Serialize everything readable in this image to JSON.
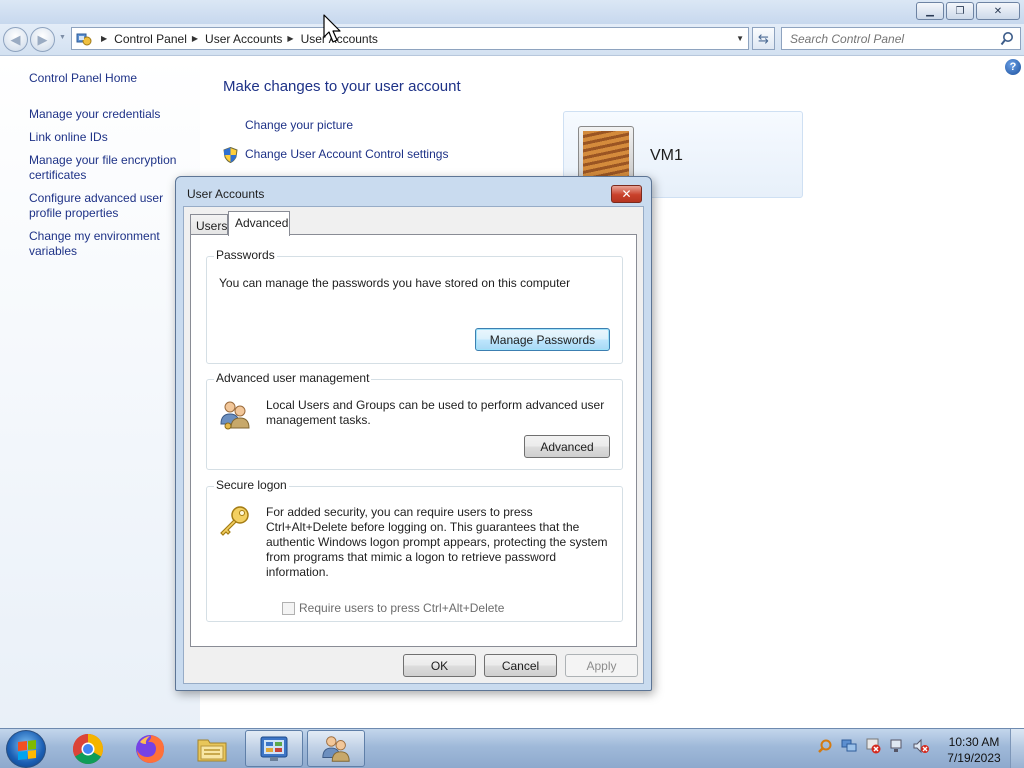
{
  "window": {
    "address": {
      "crumbs": [
        "Control Panel",
        "User Accounts",
        "User Accounts"
      ]
    },
    "search": {
      "placeholder": "Search Control Panel"
    },
    "left_pane": {
      "home": "Control Panel Home",
      "links": [
        "Manage your credentials",
        "Link online IDs",
        "Manage your file encryption certificates",
        "Configure advanced user profile properties",
        "Change my environment variables"
      ]
    },
    "main": {
      "title": "Make changes to your user account",
      "tasks": [
        "Change your picture",
        "Change User Account Control settings"
      ],
      "account": {
        "name": "VM1"
      }
    }
  },
  "dialog": {
    "title": "User Accounts",
    "close_glyph": "✕",
    "tabs": [
      "Users",
      "Advanced"
    ],
    "active_tab": "Advanced",
    "passwords": {
      "heading": "Passwords",
      "text": "You can manage the passwords you have stored on this computer",
      "button": "Manage Passwords"
    },
    "advanced_mgmt": {
      "heading": "Advanced user management",
      "text": "Local Users and Groups can be used to perform advanced user management tasks.",
      "button": "Advanced"
    },
    "secure_logon": {
      "heading": "Secure logon",
      "text": "For added security, you can require users to press Ctrl+Alt+Delete before logging on. This guarantees that the authentic Windows logon prompt appears, protecting the system from programs that mimic a logon to retrieve password information.",
      "checkbox_label": "Require users to press Ctrl+Alt+Delete",
      "checkbox_checked": false
    },
    "buttons": {
      "ok": "OK",
      "cancel": "Cancel",
      "apply": "Apply"
    }
  },
  "taskbar": {
    "items": [
      "chrome-icon",
      "firefox-icon",
      "file-explorer-icon",
      "control-panel-icon",
      "user-accounts-icon"
    ],
    "clock": {
      "time": "10:30 AM",
      "date": "7/19/2023"
    }
  }
}
